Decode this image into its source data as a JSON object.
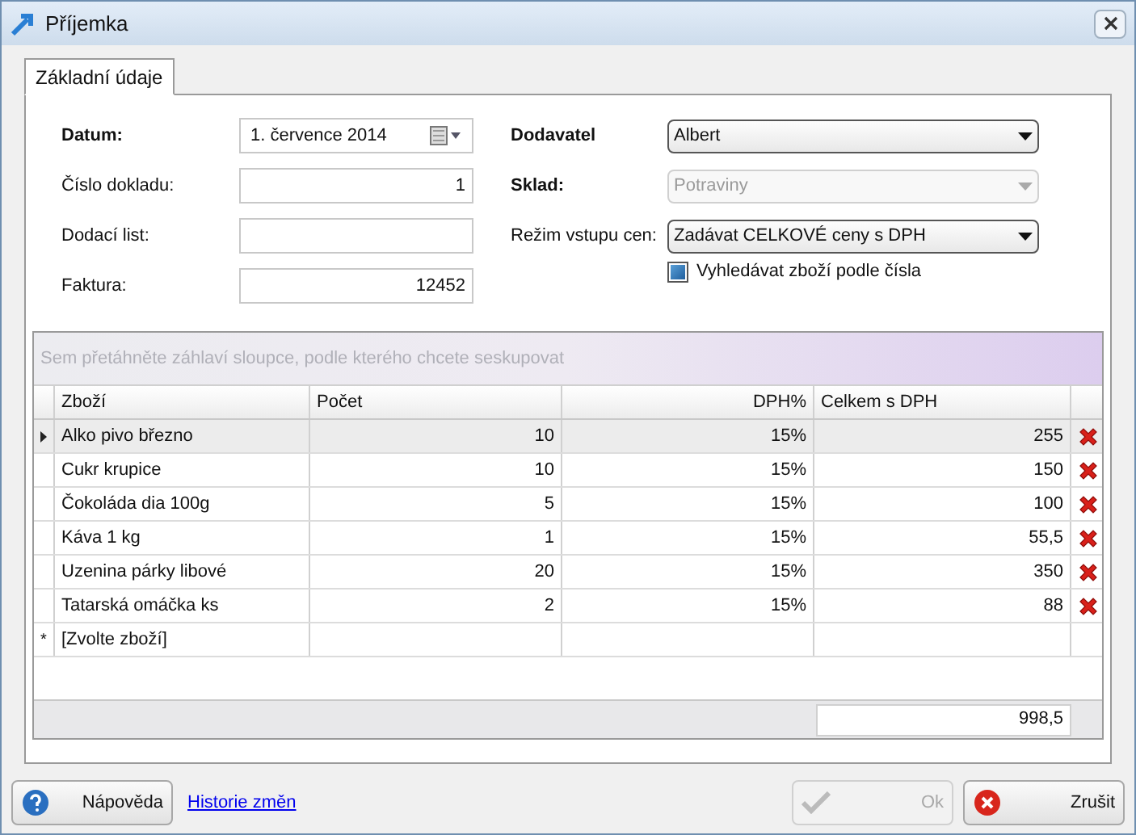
{
  "window": {
    "title": "Příjemka"
  },
  "tabs": [
    {
      "label": "Základní údaje",
      "selected": true
    }
  ],
  "left_fields": [
    {
      "label": "Datum:",
      "bold": true,
      "kind": "date",
      "value": "1. července 2014"
    },
    {
      "label": "Číslo dokladu:",
      "bold": false,
      "kind": "number",
      "value": "1"
    },
    {
      "label": "Dodací list:",
      "bold": false,
      "kind": "text"
    },
    {
      "label": "Faktura:",
      "bold": false,
      "kind": "number",
      "value": "12452"
    }
  ],
  "right_fields": [
    {
      "label": "Dodavatel",
      "bold": true,
      "value": "Albert",
      "disabled": false
    },
    {
      "label": "Sklad:",
      "bold": true,
      "value": "Potraviny",
      "disabled": true
    },
    {
      "label": "Režim vstupu cen:",
      "bold": false,
      "value": "Zadávat CELKOVÉ ceny s DPH",
      "disabled": false
    }
  ],
  "search_by_number": {
    "label": "Vyhledávat zboží podle čísla",
    "checked": true
  },
  "grid": {
    "group_panel": "Sem přetáhněte záhlaví sloupce, podle kterého chcete seskupovat",
    "columns": [
      "Zboží",
      "Počet",
      "DPH%",
      "Celkem s DPH"
    ],
    "rows": [
      {
        "cells": [
          "Alko pivo březno",
          "10",
          "15%",
          "255"
        ],
        "selected": true
      },
      {
        "cells": [
          "Cukr krupice",
          "10",
          "15%",
          "150"
        ],
        "selected": false
      },
      {
        "cells": [
          "Čokoláda dia 100g",
          "5",
          "15%",
          "100"
        ],
        "selected": false
      },
      {
        "cells": [
          "Káva 1 kg",
          "1",
          "15%",
          "55,5"
        ],
        "selected": false
      },
      {
        "cells": [
          "Uzenina párky libové",
          "20",
          "15%",
          "350"
        ],
        "selected": false
      },
      {
        "cells": [
          "Tatarská omáčka ks",
          "2",
          "15%",
          "88"
        ],
        "selected": false
      }
    ],
    "new_row": {
      "marker": "*",
      "text": "[Zvolte zboží]"
    },
    "total": "998,5"
  },
  "buttons": {
    "help": "Nápověda",
    "history_link": "Historie změn",
    "ok": {
      "label": "Ok",
      "disabled": true
    },
    "cancel": {
      "label": "Zrušit",
      "disabled": false
    }
  }
}
